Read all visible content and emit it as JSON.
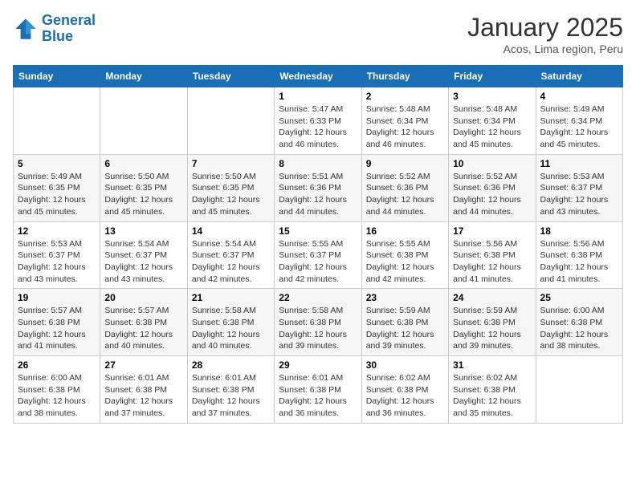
{
  "logo": {
    "line1": "General",
    "line2": "Blue"
  },
  "title": "January 2025",
  "location": "Acos, Lima region, Peru",
  "weekdays": [
    "Sunday",
    "Monday",
    "Tuesday",
    "Wednesday",
    "Thursday",
    "Friday",
    "Saturday"
  ],
  "weeks": [
    [
      {
        "day": "",
        "sunrise": "",
        "sunset": "",
        "daylight": ""
      },
      {
        "day": "",
        "sunrise": "",
        "sunset": "",
        "daylight": ""
      },
      {
        "day": "",
        "sunrise": "",
        "sunset": "",
        "daylight": ""
      },
      {
        "day": "1",
        "sunrise": "Sunrise: 5:47 AM",
        "sunset": "Sunset: 6:33 PM",
        "daylight": "Daylight: 12 hours and 46 minutes."
      },
      {
        "day": "2",
        "sunrise": "Sunrise: 5:48 AM",
        "sunset": "Sunset: 6:34 PM",
        "daylight": "Daylight: 12 hours and 46 minutes."
      },
      {
        "day": "3",
        "sunrise": "Sunrise: 5:48 AM",
        "sunset": "Sunset: 6:34 PM",
        "daylight": "Daylight: 12 hours and 45 minutes."
      },
      {
        "day": "4",
        "sunrise": "Sunrise: 5:49 AM",
        "sunset": "Sunset: 6:34 PM",
        "daylight": "Daylight: 12 hours and 45 minutes."
      }
    ],
    [
      {
        "day": "5",
        "sunrise": "Sunrise: 5:49 AM",
        "sunset": "Sunset: 6:35 PM",
        "daylight": "Daylight: 12 hours and 45 minutes."
      },
      {
        "day": "6",
        "sunrise": "Sunrise: 5:50 AM",
        "sunset": "Sunset: 6:35 PM",
        "daylight": "Daylight: 12 hours and 45 minutes."
      },
      {
        "day": "7",
        "sunrise": "Sunrise: 5:50 AM",
        "sunset": "Sunset: 6:35 PM",
        "daylight": "Daylight: 12 hours and 45 minutes."
      },
      {
        "day": "8",
        "sunrise": "Sunrise: 5:51 AM",
        "sunset": "Sunset: 6:36 PM",
        "daylight": "Daylight: 12 hours and 44 minutes."
      },
      {
        "day": "9",
        "sunrise": "Sunrise: 5:52 AM",
        "sunset": "Sunset: 6:36 PM",
        "daylight": "Daylight: 12 hours and 44 minutes."
      },
      {
        "day": "10",
        "sunrise": "Sunrise: 5:52 AM",
        "sunset": "Sunset: 6:36 PM",
        "daylight": "Daylight: 12 hours and 44 minutes."
      },
      {
        "day": "11",
        "sunrise": "Sunrise: 5:53 AM",
        "sunset": "Sunset: 6:37 PM",
        "daylight": "Daylight: 12 hours and 43 minutes."
      }
    ],
    [
      {
        "day": "12",
        "sunrise": "Sunrise: 5:53 AM",
        "sunset": "Sunset: 6:37 PM",
        "daylight": "Daylight: 12 hours and 43 minutes."
      },
      {
        "day": "13",
        "sunrise": "Sunrise: 5:54 AM",
        "sunset": "Sunset: 6:37 PM",
        "daylight": "Daylight: 12 hours and 43 minutes."
      },
      {
        "day": "14",
        "sunrise": "Sunrise: 5:54 AM",
        "sunset": "Sunset: 6:37 PM",
        "daylight": "Daylight: 12 hours and 42 minutes."
      },
      {
        "day": "15",
        "sunrise": "Sunrise: 5:55 AM",
        "sunset": "Sunset: 6:37 PM",
        "daylight": "Daylight: 12 hours and 42 minutes."
      },
      {
        "day": "16",
        "sunrise": "Sunrise: 5:55 AM",
        "sunset": "Sunset: 6:38 PM",
        "daylight": "Daylight: 12 hours and 42 minutes."
      },
      {
        "day": "17",
        "sunrise": "Sunrise: 5:56 AM",
        "sunset": "Sunset: 6:38 PM",
        "daylight": "Daylight: 12 hours and 41 minutes."
      },
      {
        "day": "18",
        "sunrise": "Sunrise: 5:56 AM",
        "sunset": "Sunset: 6:38 PM",
        "daylight": "Daylight: 12 hours and 41 minutes."
      }
    ],
    [
      {
        "day": "19",
        "sunrise": "Sunrise: 5:57 AM",
        "sunset": "Sunset: 6:38 PM",
        "daylight": "Daylight: 12 hours and 41 minutes."
      },
      {
        "day": "20",
        "sunrise": "Sunrise: 5:57 AM",
        "sunset": "Sunset: 6:38 PM",
        "daylight": "Daylight: 12 hours and 40 minutes."
      },
      {
        "day": "21",
        "sunrise": "Sunrise: 5:58 AM",
        "sunset": "Sunset: 6:38 PM",
        "daylight": "Daylight: 12 hours and 40 minutes."
      },
      {
        "day": "22",
        "sunrise": "Sunrise: 5:58 AM",
        "sunset": "Sunset: 6:38 PM",
        "daylight": "Daylight: 12 hours and 39 minutes."
      },
      {
        "day": "23",
        "sunrise": "Sunrise: 5:59 AM",
        "sunset": "Sunset: 6:38 PM",
        "daylight": "Daylight: 12 hours and 39 minutes."
      },
      {
        "day": "24",
        "sunrise": "Sunrise: 5:59 AM",
        "sunset": "Sunset: 6:38 PM",
        "daylight": "Daylight: 12 hours and 39 minutes."
      },
      {
        "day": "25",
        "sunrise": "Sunrise: 6:00 AM",
        "sunset": "Sunset: 6:38 PM",
        "daylight": "Daylight: 12 hours and 38 minutes."
      }
    ],
    [
      {
        "day": "26",
        "sunrise": "Sunrise: 6:00 AM",
        "sunset": "Sunset: 6:38 PM",
        "daylight": "Daylight: 12 hours and 38 minutes."
      },
      {
        "day": "27",
        "sunrise": "Sunrise: 6:01 AM",
        "sunset": "Sunset: 6:38 PM",
        "daylight": "Daylight: 12 hours and 37 minutes."
      },
      {
        "day": "28",
        "sunrise": "Sunrise: 6:01 AM",
        "sunset": "Sunset: 6:38 PM",
        "daylight": "Daylight: 12 hours and 37 minutes."
      },
      {
        "day": "29",
        "sunrise": "Sunrise: 6:01 AM",
        "sunset": "Sunset: 6:38 PM",
        "daylight": "Daylight: 12 hours and 36 minutes."
      },
      {
        "day": "30",
        "sunrise": "Sunrise: 6:02 AM",
        "sunset": "Sunset: 6:38 PM",
        "daylight": "Daylight: 12 hours and 36 minutes."
      },
      {
        "day": "31",
        "sunrise": "Sunrise: 6:02 AM",
        "sunset": "Sunset: 6:38 PM",
        "daylight": "Daylight: 12 hours and 35 minutes."
      },
      {
        "day": "",
        "sunrise": "",
        "sunset": "",
        "daylight": ""
      }
    ]
  ]
}
